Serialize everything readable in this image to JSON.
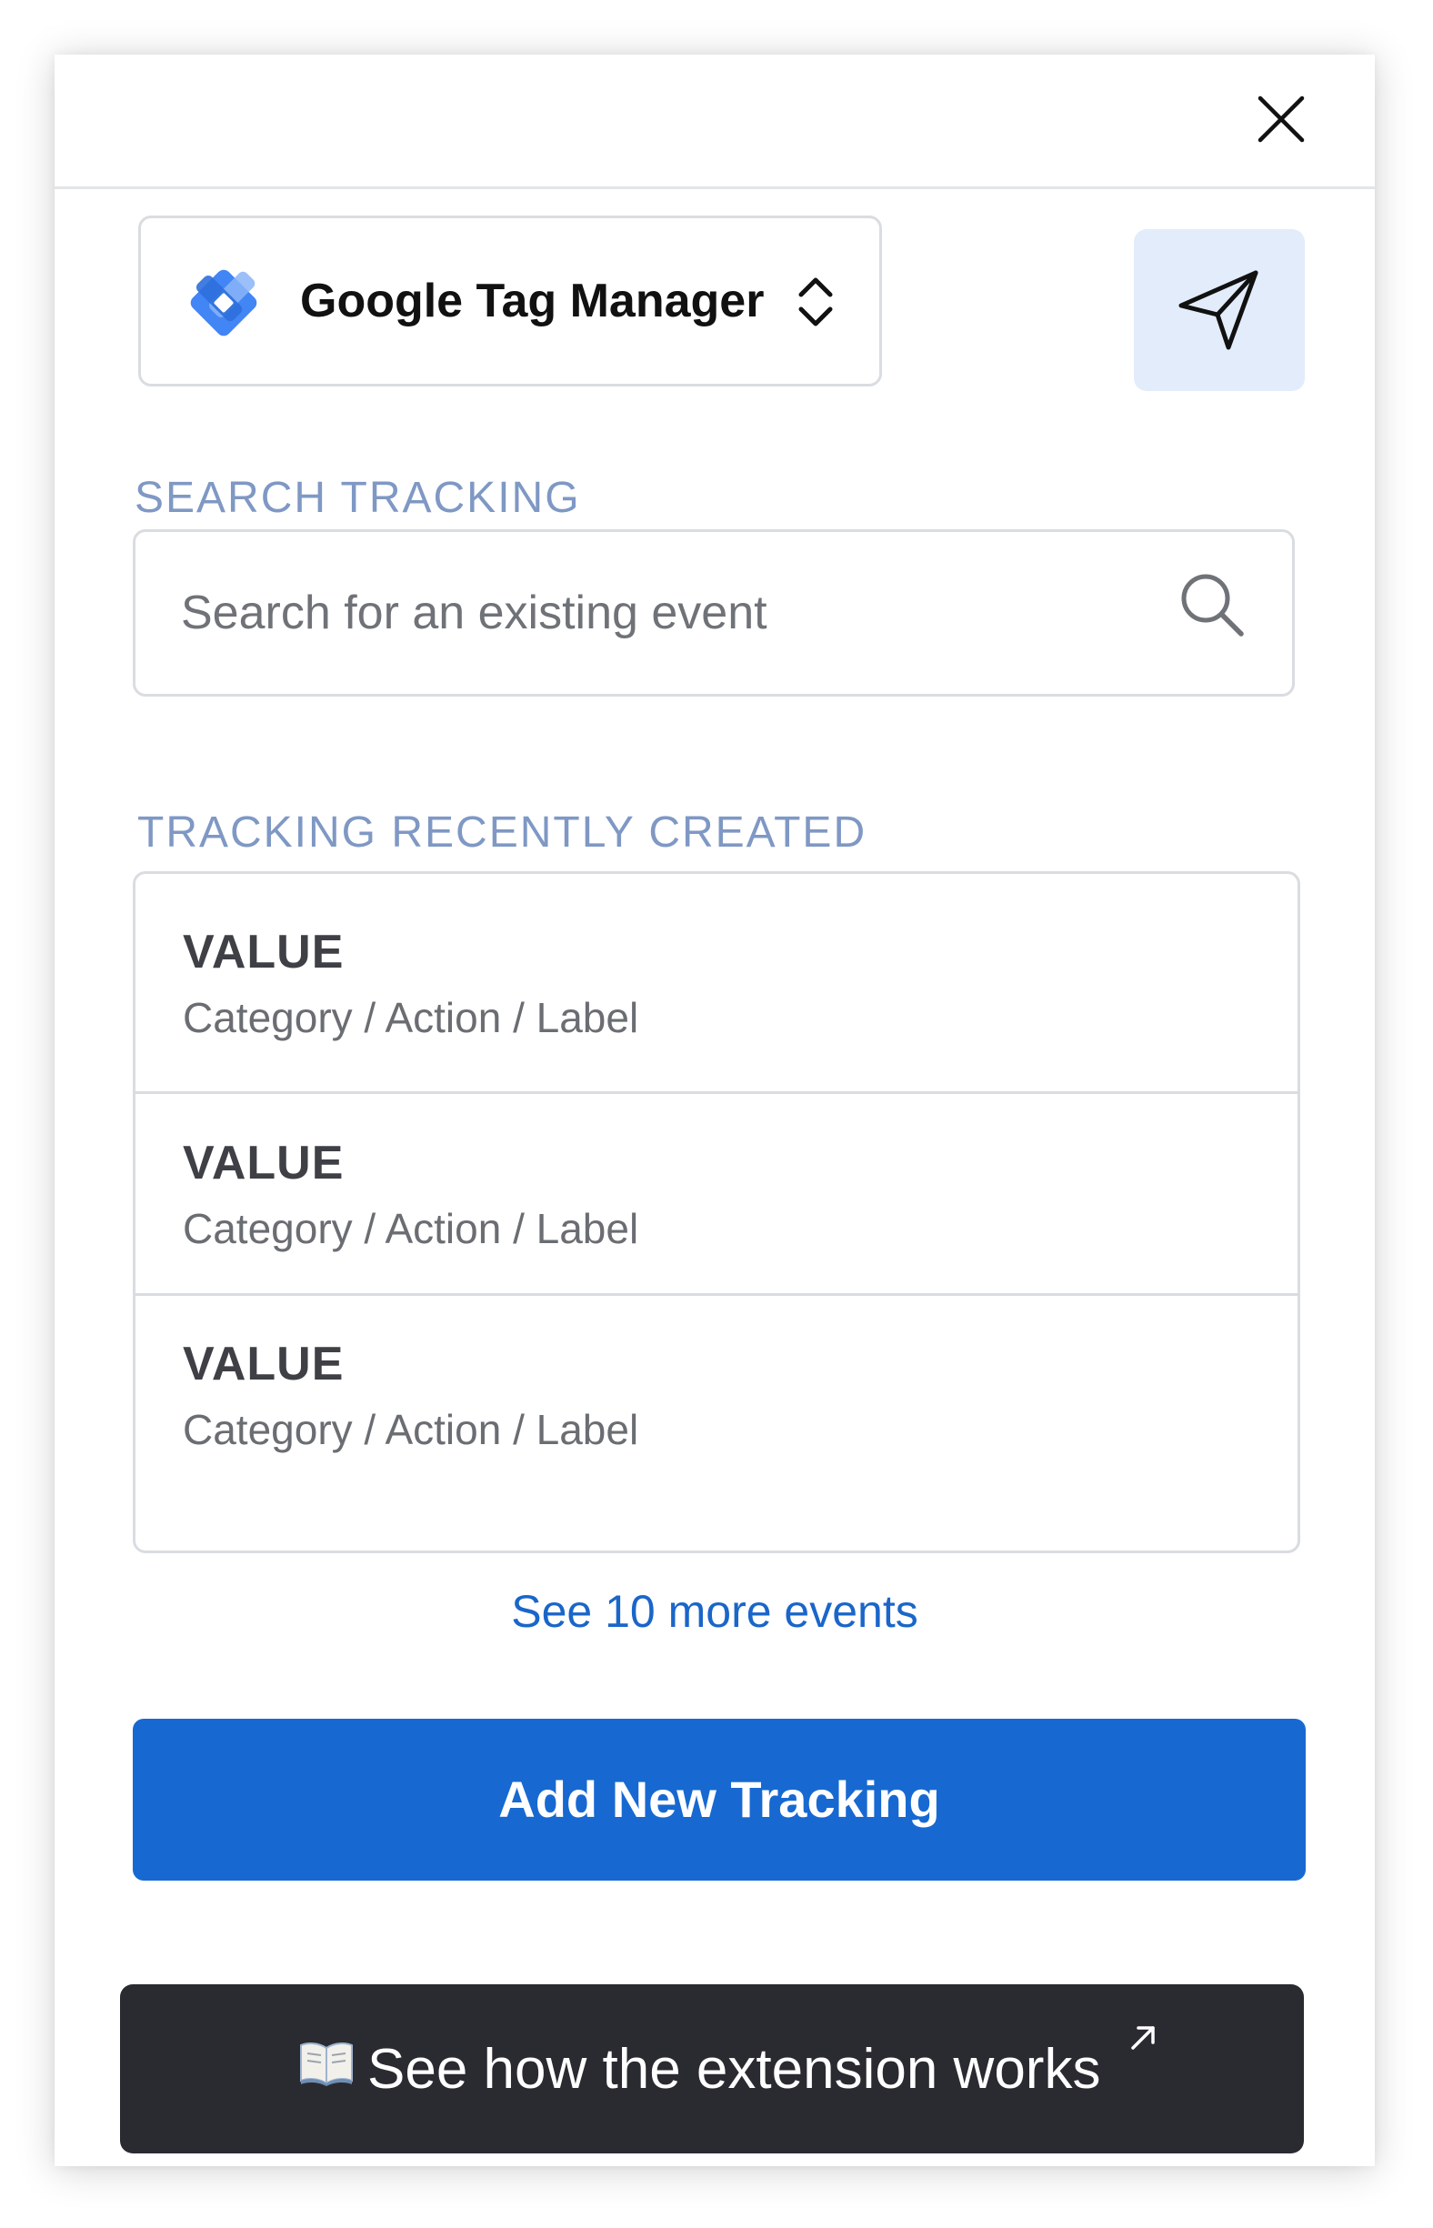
{
  "header": {
    "close_icon": "close-icon"
  },
  "selector": {
    "logo_icon": "google-tag-manager-logo",
    "label": "Google Tag Manager",
    "chevron_icon": "chevron-up-down-icon"
  },
  "send_button": {
    "icon": "send-icon"
  },
  "search": {
    "section_label": "SEARCH TRACKING",
    "placeholder": "Search for an existing event",
    "value": "",
    "icon": "search-icon"
  },
  "recent": {
    "section_label": "TRACKING RECENTLY CREATED",
    "events": [
      {
        "value": "VALUE",
        "path": "Category / Action / Label"
      },
      {
        "value": "VALUE",
        "path": "Category / Action / Label"
      },
      {
        "value": "VALUE",
        "path": "Category / Action / Label"
      }
    ],
    "see_more": "See 10 more events"
  },
  "actions": {
    "add_label": "Add New Tracking",
    "howto_label": "See how the extension works",
    "howto_icon": "book-icon",
    "external_icon": "external-link-icon"
  },
  "colors": {
    "primary": "#1769d1",
    "section_label": "#7f98c4",
    "send_button_bg": "#e3ecfb",
    "dark_button_bg": "#2a2b31",
    "link": "#1a66c9"
  }
}
